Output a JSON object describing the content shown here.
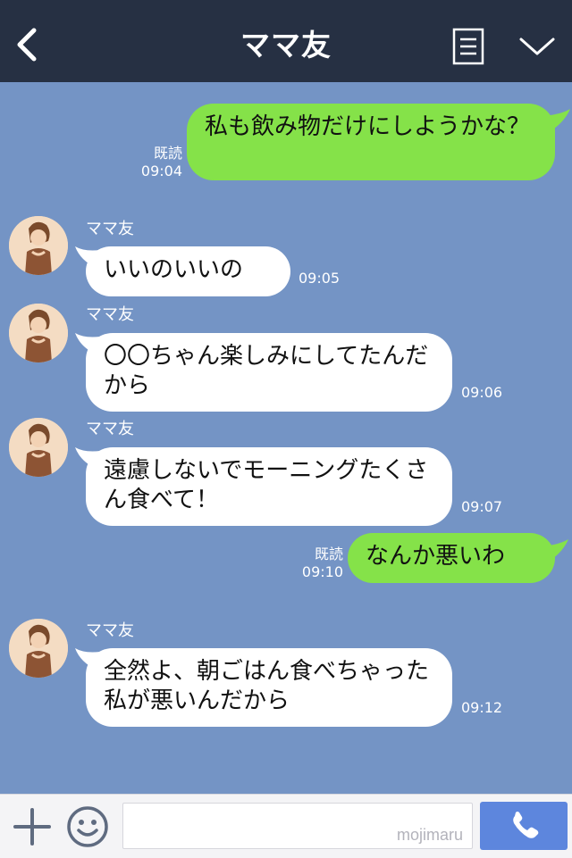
{
  "header": {
    "title": "ママ友"
  },
  "messages": [
    {
      "side": "me",
      "text": "私も飲み物だけにしようかな？",
      "read": "既読",
      "time": "09:04"
    },
    {
      "side": "them",
      "sender": "ママ友",
      "text": "いいのいいの",
      "time": "09:05"
    },
    {
      "side": "them",
      "sender": "ママ友",
      "text": "〇〇ちゃん楽しみにしてたんだから",
      "time": "09:06"
    },
    {
      "side": "them",
      "sender": "ママ友",
      "text": "遠慮しないでモーニングたくさん食べて！",
      "time": "09:07"
    },
    {
      "side": "me",
      "text": "なんか悪いわ",
      "read": "既読",
      "time": "09:10"
    },
    {
      "side": "them",
      "sender": "ママ友",
      "text": "全然よ、朝ごはん食べちゃった私が悪いんだから",
      "time": "09:12"
    }
  ],
  "footer": {
    "watermark": "mojimaru"
  },
  "colors": {
    "header": "#263043",
    "background": "#7494c5",
    "my_bubble": "#85e249",
    "their_bubble": "#ffffff",
    "call_button": "#5d86dd"
  },
  "icons": [
    "chevron-left-icon",
    "menu-list-icon",
    "chevron-down-icon",
    "plus-icon",
    "smiley-icon",
    "phone-icon"
  ]
}
